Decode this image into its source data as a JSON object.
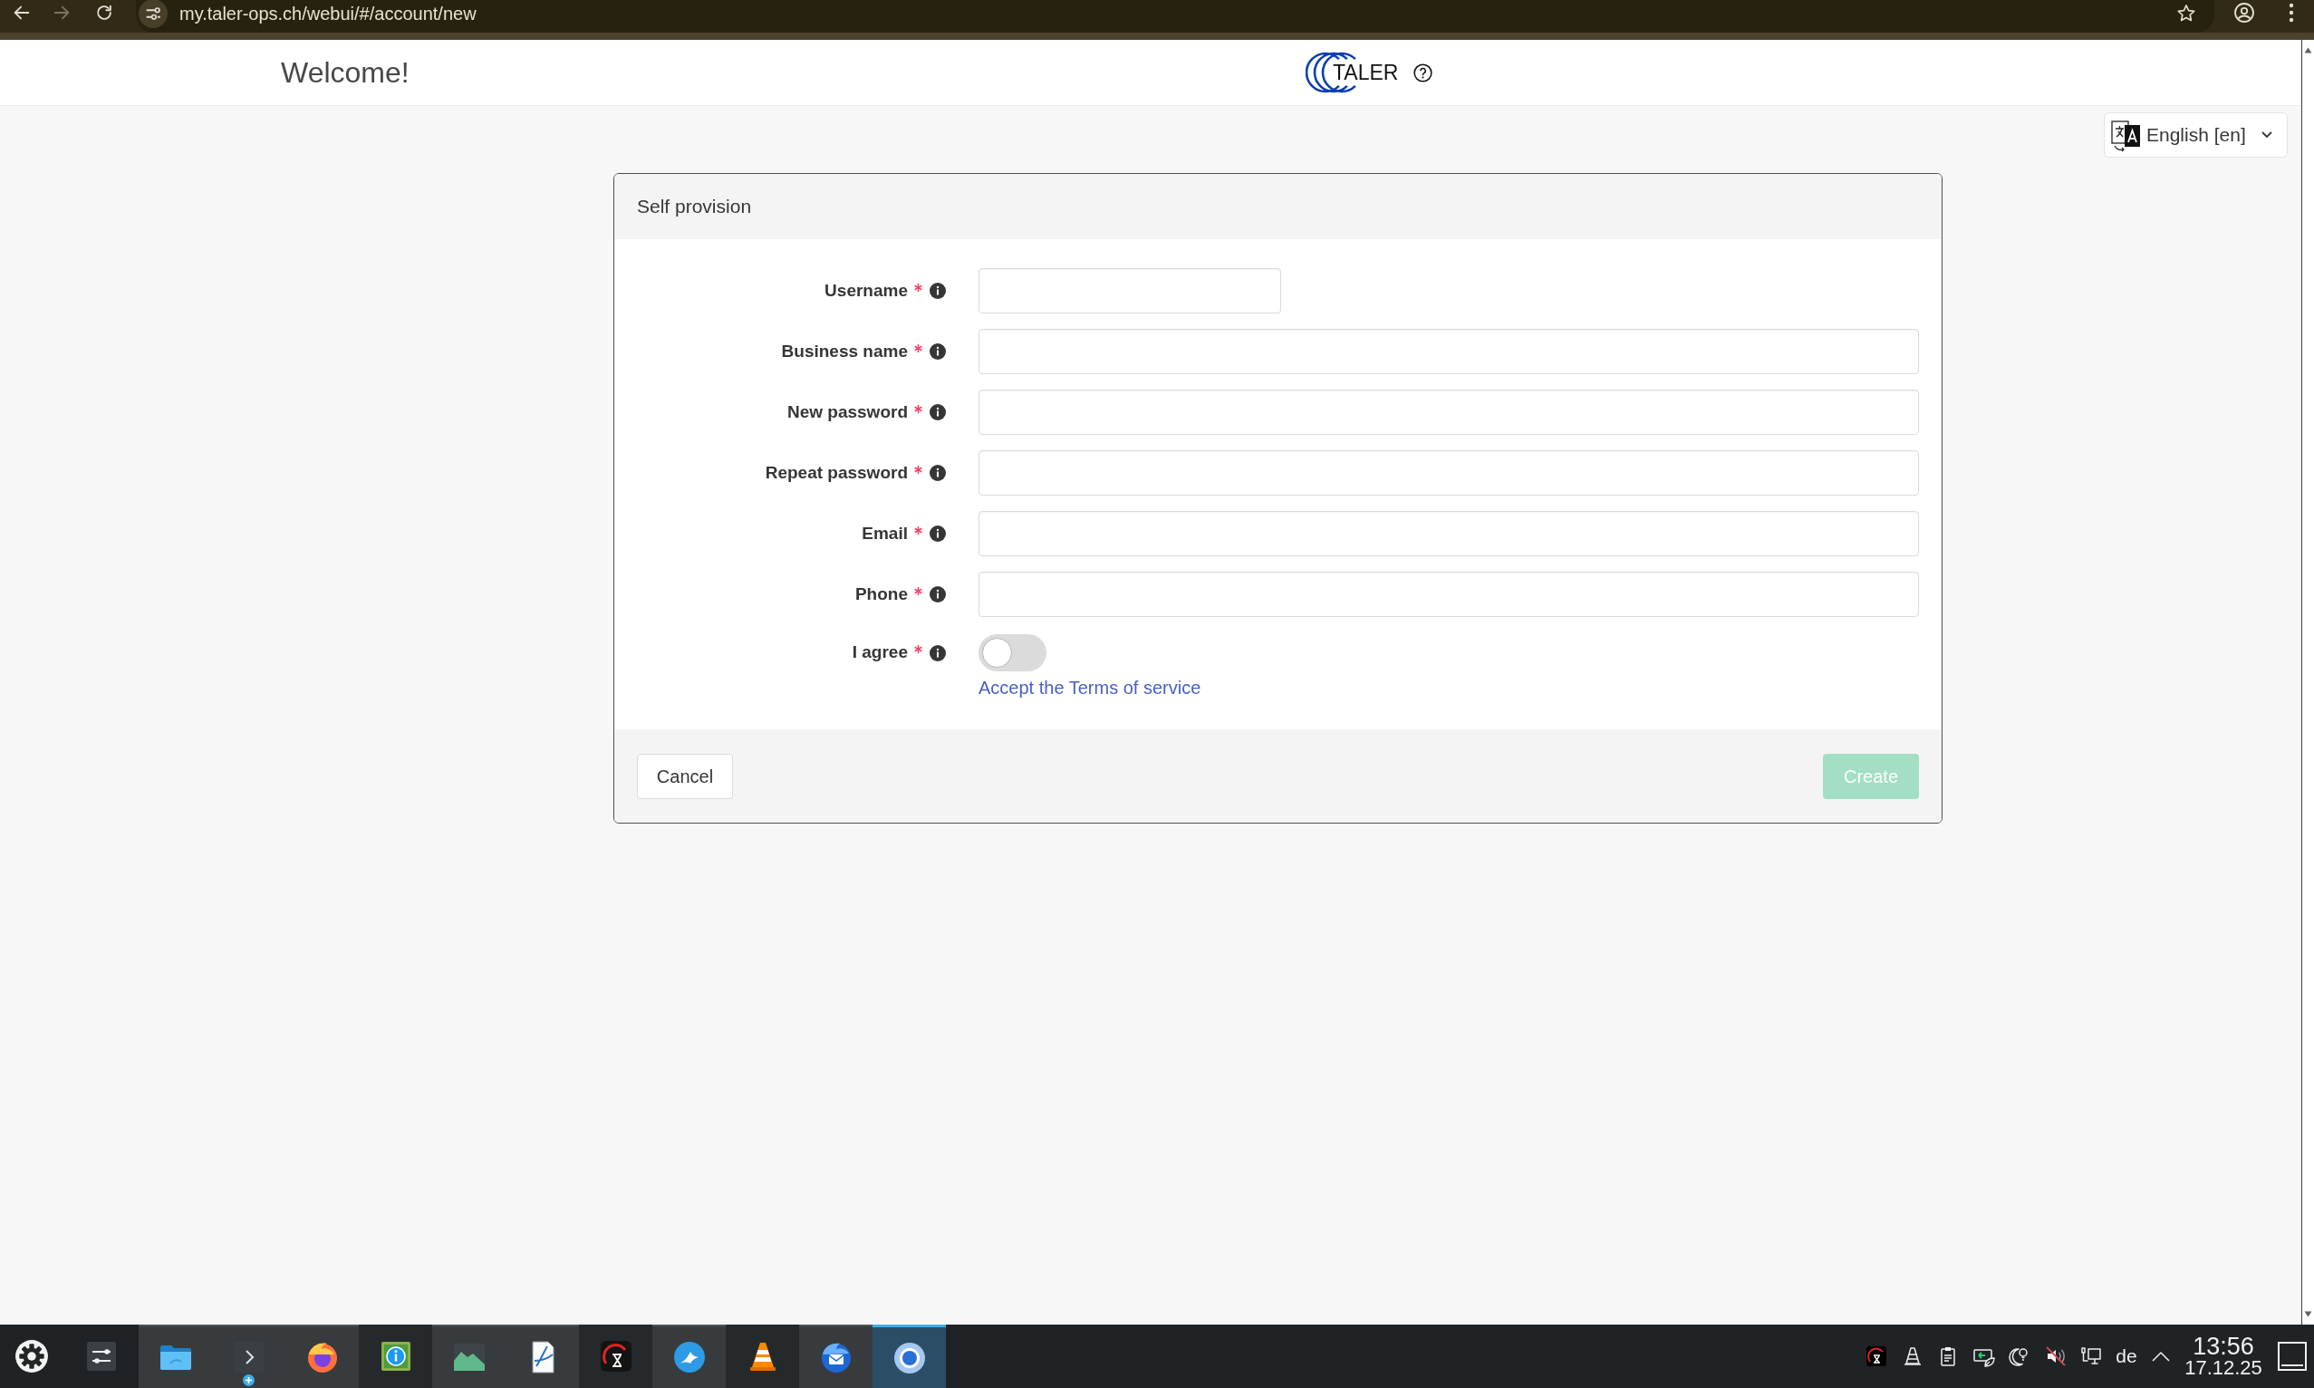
{
  "browser": {
    "url": "my.taler-ops.ch/webui/#/account/new",
    "forward_disabled": true
  },
  "header": {
    "title": "Welcome!",
    "logo_text": "TALER"
  },
  "language_select": {
    "value": "English [en]"
  },
  "form": {
    "title": "Self provision",
    "fields": [
      {
        "kind": "compact",
        "label": "Username",
        "required": true
      },
      {
        "kind": "input",
        "label": "Business name",
        "required": true
      },
      {
        "kind": "input",
        "label": "New password",
        "required": true
      },
      {
        "kind": "input",
        "label": "Repeat password",
        "required": true
      },
      {
        "kind": "input",
        "label": "Email",
        "required": true
      },
      {
        "kind": "input",
        "label": "Phone",
        "required": true
      },
      {
        "kind": "switch",
        "label": "I agree",
        "required": true,
        "on": false,
        "link": "Accept the Terms of service"
      }
    ],
    "cancel": {
      "label": "Cancel"
    },
    "create": {
      "label": "Create",
      "disabled": true
    }
  },
  "taskbar": {
    "tasks": [
      {
        "running": true,
        "selected": false
      },
      {
        "running": true,
        "selected": false
      },
      {
        "running": true,
        "selected": false
      },
      {
        "running": false,
        "selected": false
      },
      {
        "running": true,
        "selected": false
      },
      {
        "running": true,
        "selected": false
      },
      {
        "running": false,
        "selected": false
      },
      {
        "running": true,
        "selected": false
      },
      {
        "running": false,
        "selected": false
      },
      {
        "running": true,
        "selected": false
      },
      {
        "running": true,
        "selected": true
      }
    ],
    "tray": {
      "volume_muted": true,
      "keyboard_layout": "de"
    },
    "clock": {
      "time": "13:56",
      "date": "17.12.25"
    }
  }
}
